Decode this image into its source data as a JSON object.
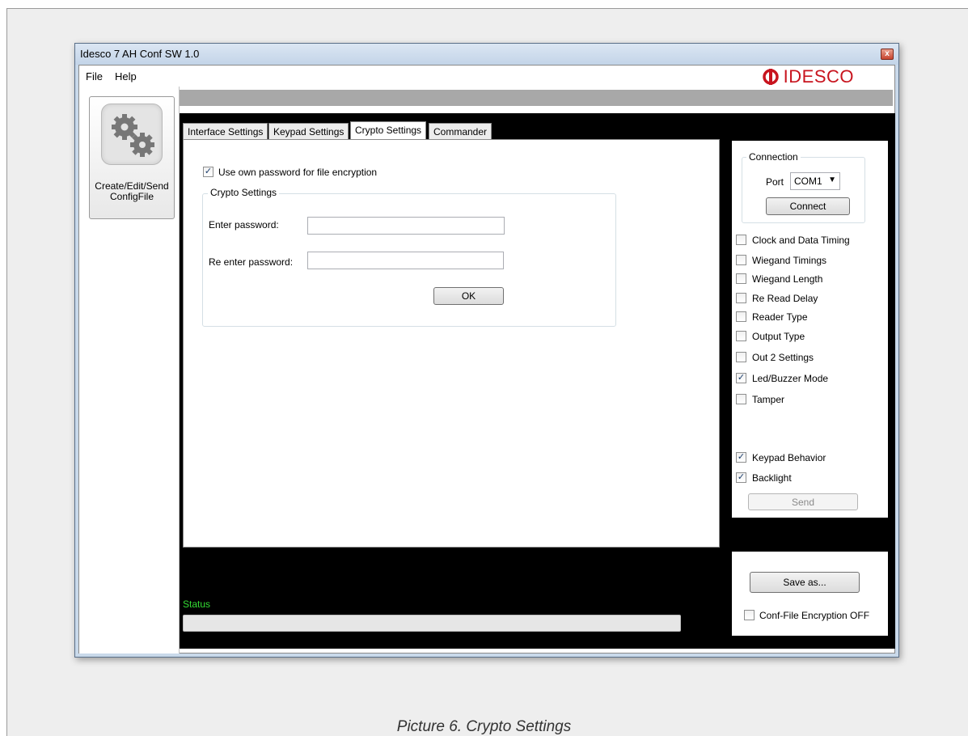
{
  "window": {
    "title": "Idesco 7 AH Conf SW 1.0",
    "close_glyph": "x"
  },
  "menu": {
    "file": "File",
    "help": "Help"
  },
  "logo": {
    "text": "IDESCO",
    "color": "#c8141e"
  },
  "sidebar": {
    "button_label_line1": "Create/Edit/Send",
    "button_label_line2": "ConfigFile",
    "icon": "gears-icon"
  },
  "tabs": [
    {
      "label": "Interface Settings",
      "active": false
    },
    {
      "label": "Keypad Settings",
      "active": false
    },
    {
      "label": "Crypto Settings",
      "active": true
    },
    {
      "label": "Commander",
      "active": false
    }
  ],
  "crypto": {
    "use_own_password_label": "Use own password for file encryption",
    "use_own_password_checked": true,
    "group_title": "Crypto Settings",
    "enter_password_label": "Enter password:",
    "enter_password_value": "",
    "reenter_password_label": "Re enter password:",
    "reenter_password_value": "",
    "ok_label": "OK"
  },
  "connection": {
    "group_title": "Connection",
    "port_label": "Port",
    "port_value": "COM1",
    "connect_label": "Connect"
  },
  "options": [
    {
      "label": "Clock and Data Timing",
      "checked": false
    },
    {
      "label": "Wiegand Timings",
      "checked": false
    },
    {
      "label": "Wiegand Length",
      "checked": false
    },
    {
      "label": "Re Read Delay",
      "checked": false
    },
    {
      "label": "Reader Type",
      "checked": false
    },
    {
      "label": "Output Type",
      "checked": false
    },
    {
      "label": "Out 2 Settings",
      "checked": false
    },
    {
      "label": "Led/Buzzer Mode",
      "checked": true
    },
    {
      "label": "Tamper",
      "checked": false
    },
    {
      "label": "Keypad Behavior",
      "checked": true
    },
    {
      "label": "Backlight",
      "checked": true
    }
  ],
  "send_label": "Send",
  "save": {
    "save_as_label": "Save as...",
    "encryption_label": "Conf-File Encryption OFF",
    "encryption_checked": false
  },
  "status": {
    "label": "Status",
    "label_color": "#33dd33"
  },
  "caption": "Picture 6. Crypto Settings"
}
